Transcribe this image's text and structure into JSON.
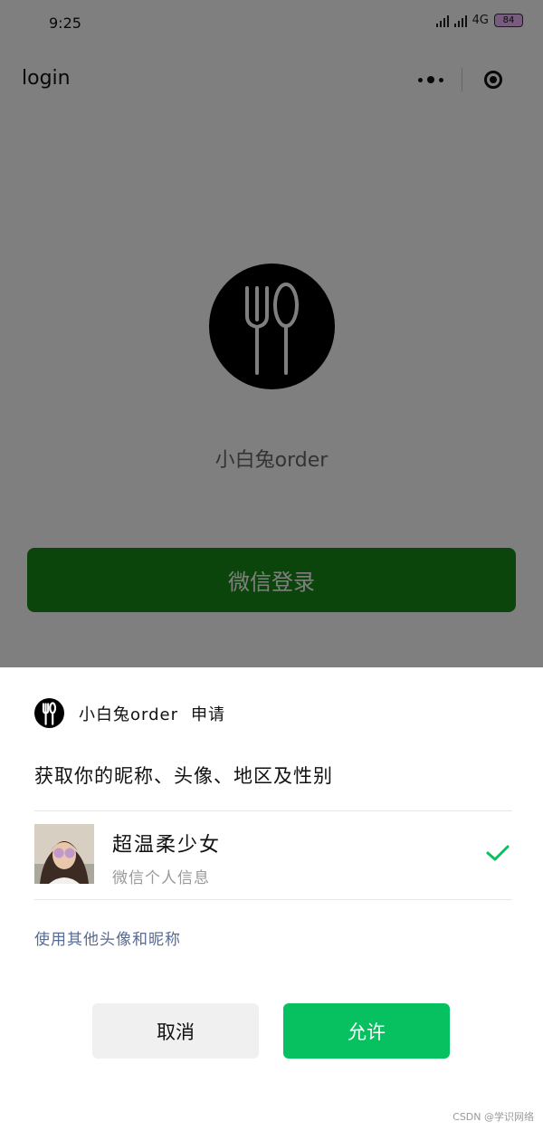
{
  "status_bar": {
    "time": "9:25",
    "network": "4G",
    "battery": "84"
  },
  "navbar": {
    "title": "login",
    "more_icon": "more-dots-icon",
    "close_icon": "target-circle-icon"
  },
  "page": {
    "app_name": "小白兔order",
    "login_button": "微信登录",
    "logo_icon": "fork-spoon-icon"
  },
  "dialog": {
    "app_name": "小白兔order",
    "request_word": "申请",
    "title": "获取你的昵称、头像、地区及性别",
    "user_name": "超温柔少女",
    "user_sub": "微信个人信息",
    "other_link": "使用其他头像和昵称",
    "cancel": "取消",
    "allow": "允许"
  },
  "watermark": "CSDN @学识网络",
  "colors": {
    "wechat_green": "#07c160",
    "login_green": "#198b19",
    "link_blue": "#576b95",
    "overlay": "rgba(0,0,0,0.5)"
  }
}
